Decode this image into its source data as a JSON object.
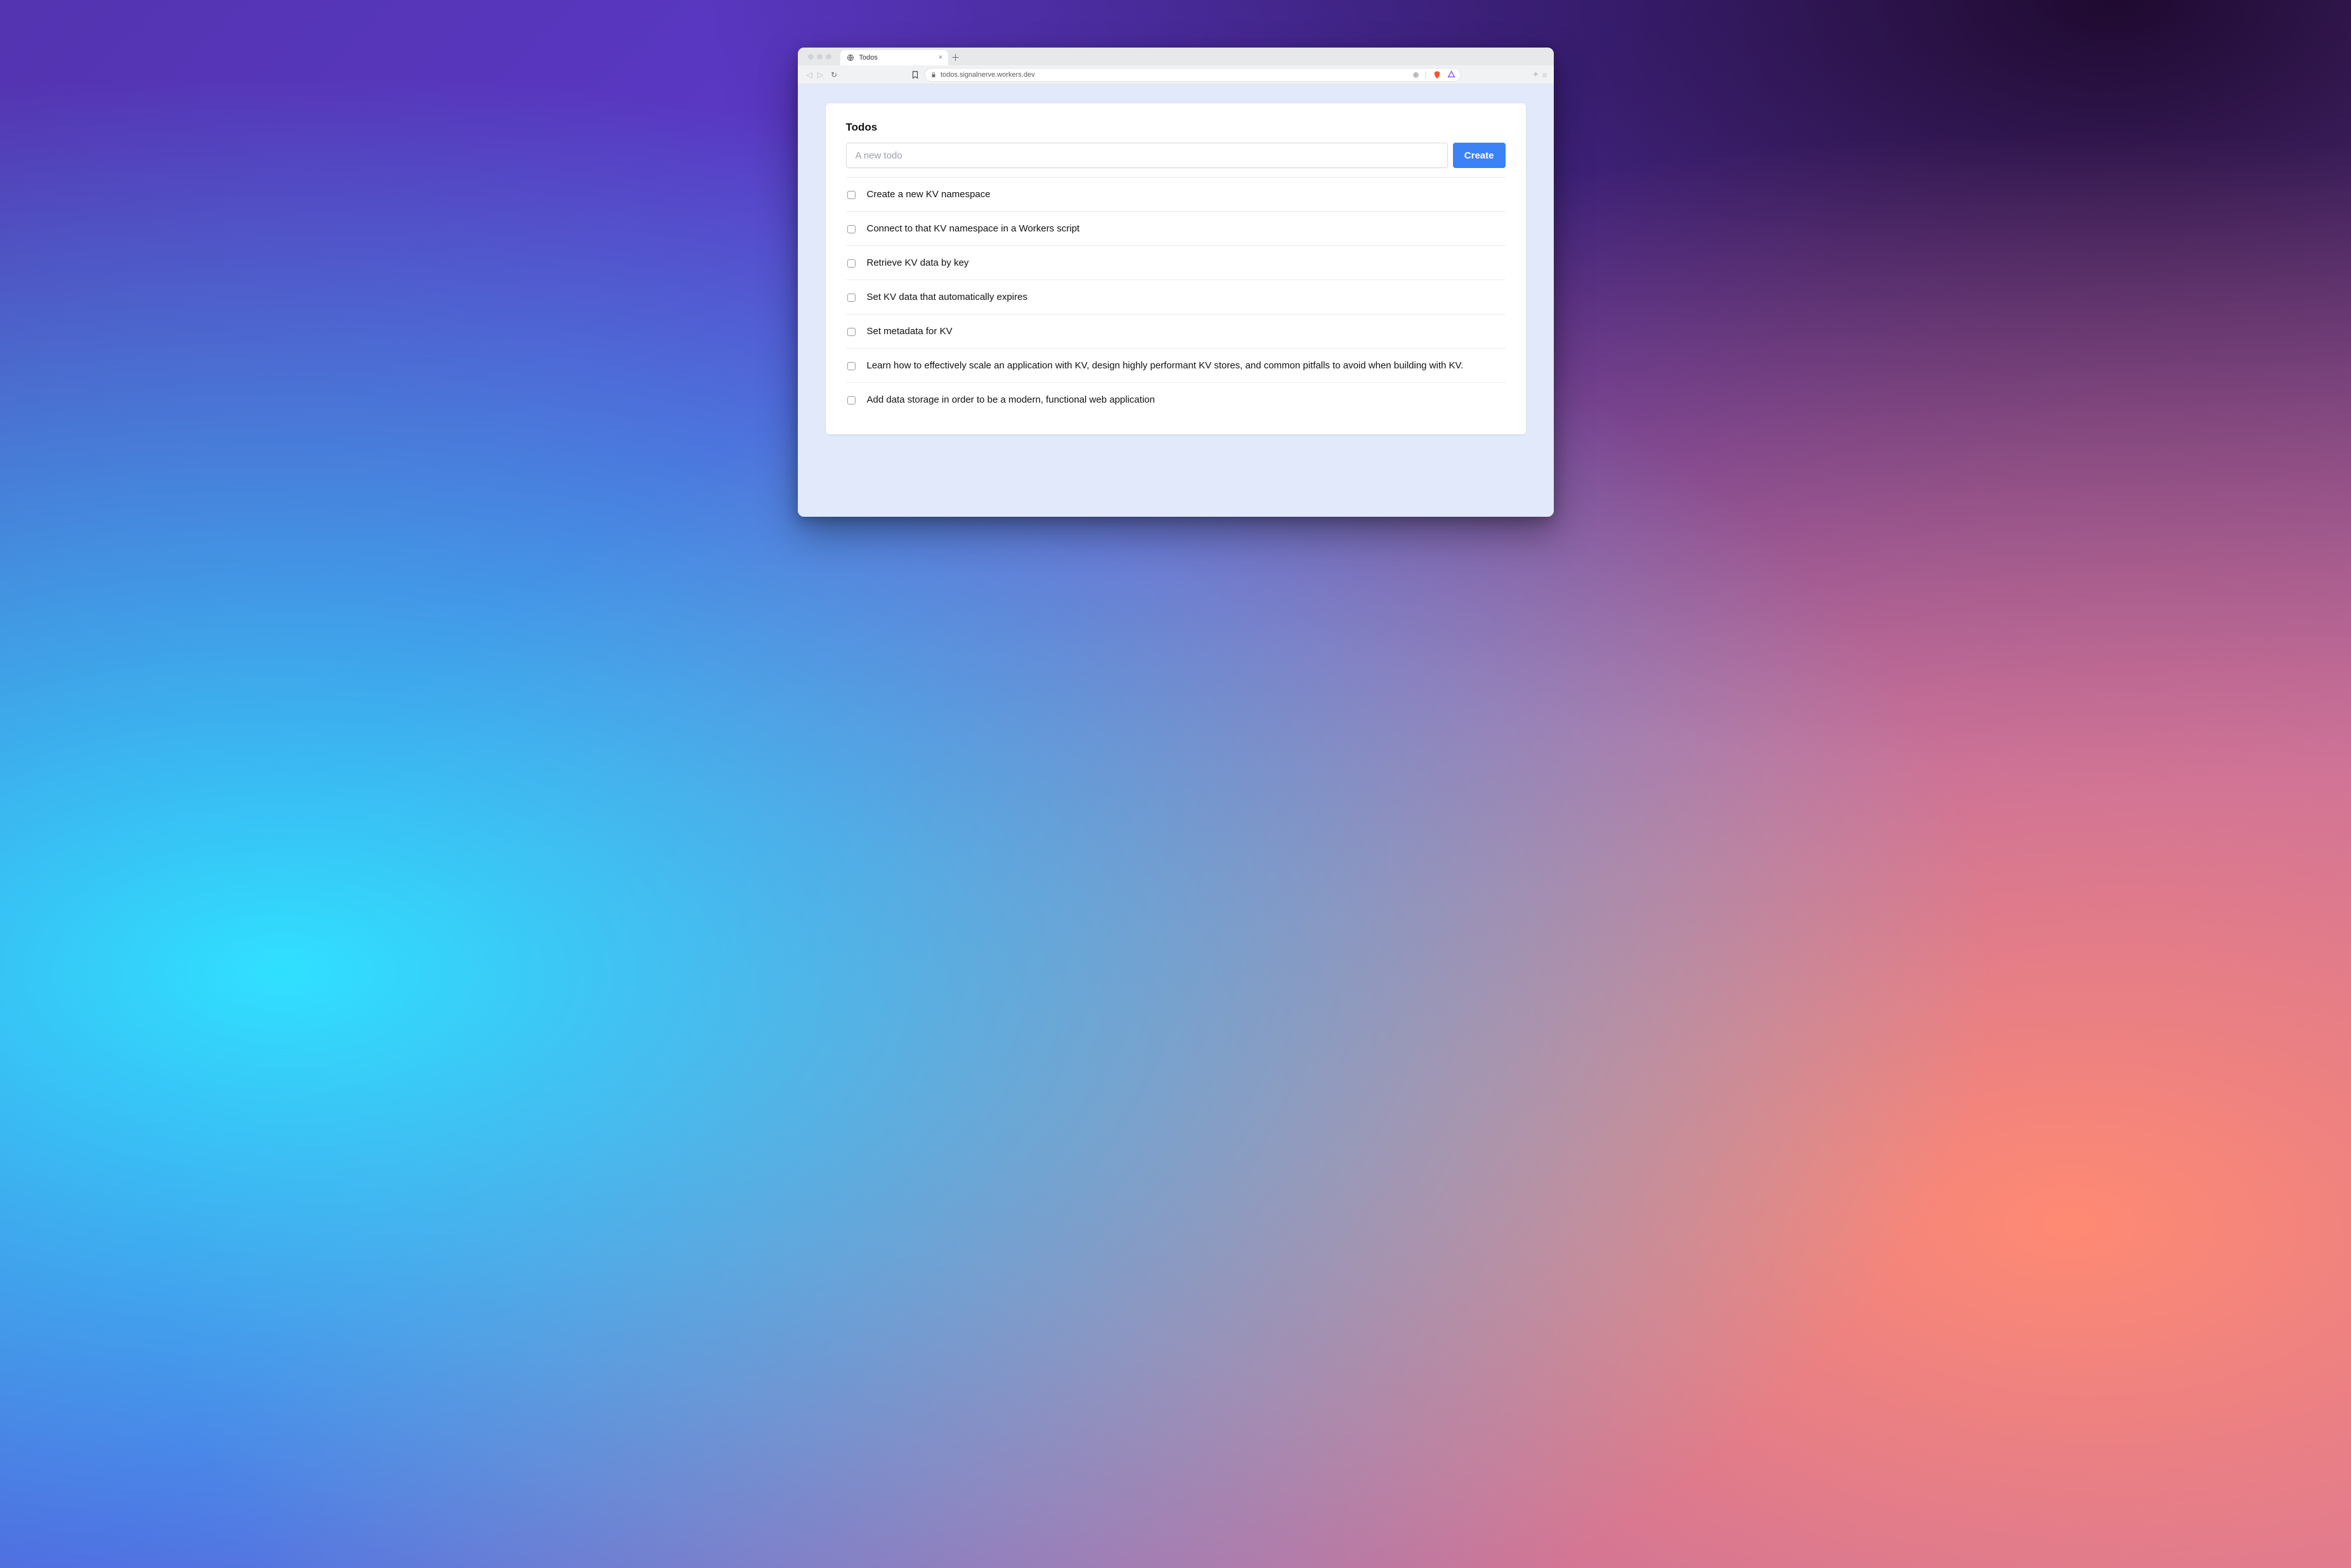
{
  "browser": {
    "tab_title": "Todos",
    "url": "todos.signalnerve.workers.dev"
  },
  "app": {
    "heading": "Todos",
    "input_placeholder": "A new todo",
    "create_label": "Create"
  },
  "todos": [
    {
      "text": "Create a new KV namespace",
      "checked": false
    },
    {
      "text": "Connect to that KV namespace in a Workers script",
      "checked": false
    },
    {
      "text": "Retrieve KV data by key",
      "checked": false
    },
    {
      "text": "Set KV data that automatically expires",
      "checked": false
    },
    {
      "text": "Set metadata for KV",
      "checked": false
    },
    {
      "text": "Learn how to effectively scale an application with KV, design highly performant KV stores, and common pitfalls to avoid when building with KV.",
      "checked": false
    },
    {
      "text": "Add data storage in order to be a modern, functional web application",
      "checked": false
    }
  ]
}
